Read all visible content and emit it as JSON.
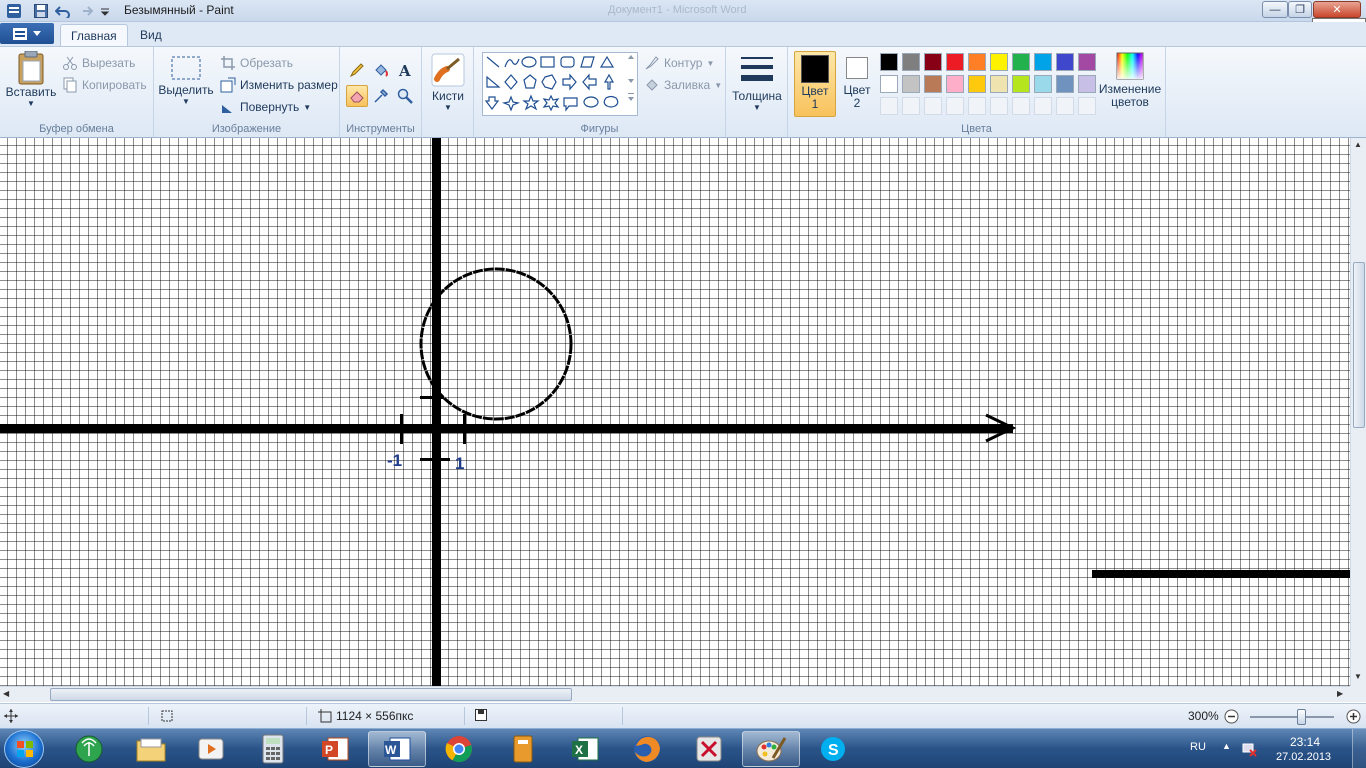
{
  "window": {
    "title": "Безымянный - Paint",
    "background_title": "Документ1 - Microsoft Word",
    "close_tooltip": "Закрыть"
  },
  "tabs": [
    {
      "label": "Главная",
      "active": true
    },
    {
      "label": "Вид",
      "active": false
    }
  ],
  "ribbon": {
    "clipboard": {
      "group_label": "Буфер обмена",
      "paste": "Вставить",
      "cut": "Вырезать",
      "copy": "Копировать"
    },
    "image": {
      "group_label": "Изображение",
      "select": "Выделить",
      "crop": "Обрезать",
      "resize": "Изменить размер",
      "rotate": "Повернуть"
    },
    "tools": {
      "group_label": "Инструменты",
      "items": [
        "pencil-icon",
        "fill-bucket-icon",
        "text-icon",
        "eraser-icon",
        "color-picker-icon",
        "magnifier-icon"
      ],
      "selected": "eraser-icon"
    },
    "brushes": {
      "label": "Кисти"
    },
    "shapes": {
      "group_label": "Фигуры",
      "outline": "Контур",
      "fill": "Заливка"
    },
    "size": {
      "label": "Толщина"
    },
    "color1": {
      "label": "Цвет 1",
      "color": "#000000"
    },
    "color2": {
      "label": "Цвет 2",
      "color": "#ffffff"
    },
    "colors": {
      "group_label": "Цвета",
      "edit_label": "Изменение цветов",
      "row1": [
        "#000000",
        "#7f7f7f",
        "#880015",
        "#ed1c24",
        "#ff7f27",
        "#fff200",
        "#22b14c",
        "#00a2e8",
        "#3f48cc",
        "#a349a4"
      ],
      "row2": [
        "#ffffff",
        "#c3c3c3",
        "#b97a57",
        "#ffaec9",
        "#ffc90e",
        "#efe4b0",
        "#b5e61d",
        "#99d9ea",
        "#7092be",
        "#c8bfe7"
      ]
    }
  },
  "canvas": {
    "label_minus_one": "-1",
    "label_one": "1"
  },
  "statusbar": {
    "image_size": "1124 × 556пкс",
    "zoom": "300%"
  },
  "taskbar": {
    "language": "RU",
    "time": "23:14",
    "date": "27.02.2013"
  }
}
